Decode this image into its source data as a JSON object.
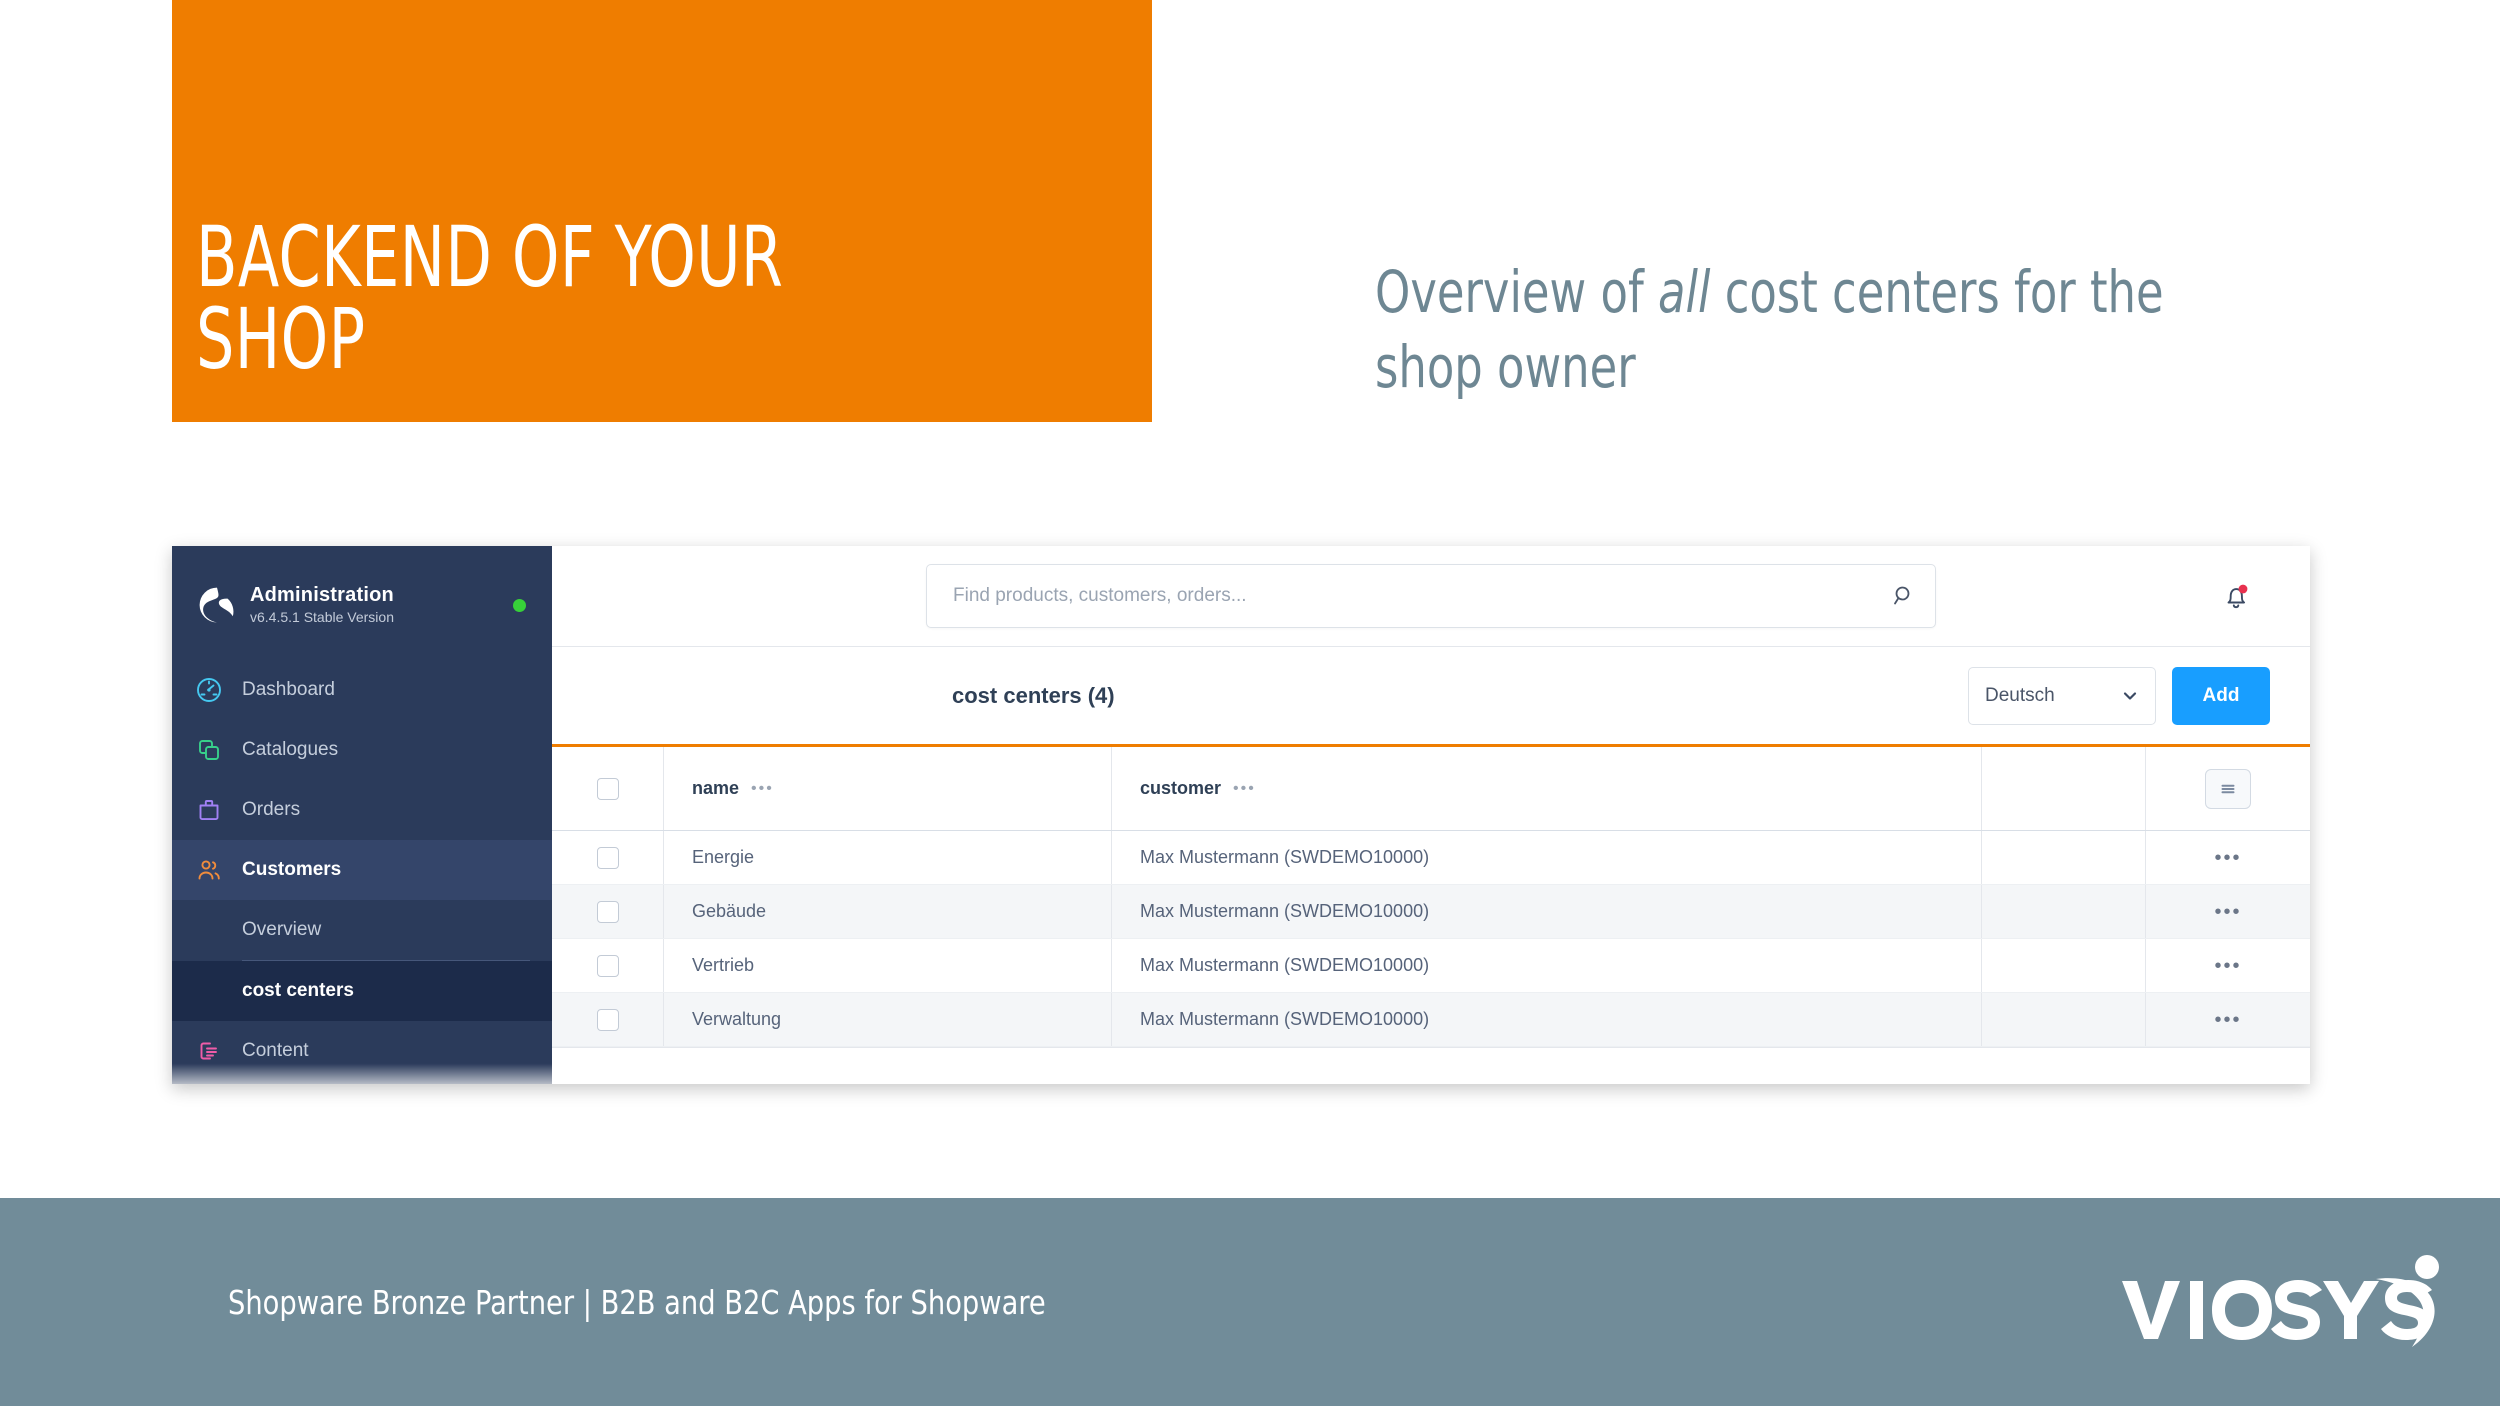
{
  "slide": {
    "title": "BACKEND OF YOUR\nSHOP",
    "subtitle_pre": "Overview of ",
    "subtitle_em": "all",
    "subtitle_post": " cost centers for the shop owner",
    "accent_orange": "#EF7D00",
    "subtitle_color": "#6E8793"
  },
  "sidebar": {
    "app_title": "Administration",
    "app_version": "v6.4.5.1 Stable Version",
    "status_color": "#37D039",
    "logo_icon": "shopware-logo-icon",
    "items": [
      {
        "label": "Dashboard",
        "icon": "dashboard-gauge-icon",
        "color": "#45C8F0",
        "active": false
      },
      {
        "label": "Catalogues",
        "icon": "catalogues-squares-icon",
        "color": "#37D08A",
        "active": false
      },
      {
        "label": "Orders",
        "icon": "orders-bag-icon",
        "color": "#A180F5",
        "active": false
      },
      {
        "label": "Customers",
        "icon": "customers-people-icon",
        "color": "#F08C3C",
        "active": true
      },
      {
        "label": "Content",
        "icon": "content-page-icon",
        "color": "#F05CA8",
        "active": false
      }
    ],
    "sub_items": [
      {
        "label": "Overview",
        "active": false
      },
      {
        "label": "cost centers",
        "active": true
      }
    ]
  },
  "topbar": {
    "search_placeholder": "Find products, customers, orders...",
    "search_value": "",
    "search_icon": "search-icon",
    "bell_icon": "notification-bell-icon",
    "bell_badge_color": "#E8314F"
  },
  "toolbar": {
    "title": "cost centers (4)",
    "language_selected": "Deutsch",
    "language_options": [
      "Deutsch"
    ],
    "add_label": "Add",
    "add_color": "#189EFF",
    "chevron_icon": "chevron-down-icon"
  },
  "grid": {
    "columns": [
      {
        "key": "name",
        "label": "name"
      },
      {
        "key": "customer",
        "label": "customer"
      }
    ],
    "header_menu_icon": "list-settings-icon",
    "row_menu_glyph": "•••",
    "column_menu_glyph": "•••",
    "rows": [
      {
        "name": "Energie",
        "customer": "Max Mustermann (SWDEMO10000)"
      },
      {
        "name": "Gebäude",
        "customer": "Max Mustermann (SWDEMO10000)"
      },
      {
        "name": "Vertrieb",
        "customer": "Max Mustermann (SWDEMO10000)"
      },
      {
        "name": "Verwaltung",
        "customer": "Max Mustermann (SWDEMO10000)"
      }
    ]
  },
  "footer": {
    "text": "Shopware Bronze Partner  |  B2B and B2C Apps for Shopware",
    "background": "#718C99",
    "brand": "VIOSYS",
    "brand_icon": "viosys-figure-icon"
  }
}
